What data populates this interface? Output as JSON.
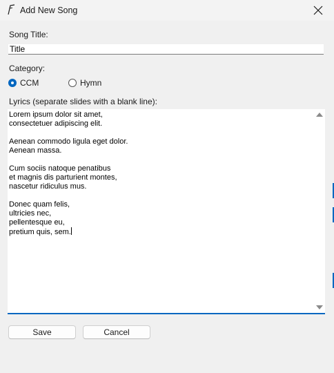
{
  "window": {
    "title": "Add New Song",
    "icon": "music-note-icon"
  },
  "form": {
    "song_title_label": "Song Title:",
    "song_title_value": "Title",
    "category_label": "Category:",
    "category_options": [
      {
        "label": "CCM",
        "checked": true
      },
      {
        "label": "Hymn",
        "checked": false
      }
    ],
    "lyrics_label": "Lyrics (separate slides with a blank line):",
    "lyrics_value": "Lorem ipsum dolor sit amet,\nconsectetuer adipiscing elit.\n\nAenean commodo ligula eget dolor.\nAenean massa.\n\nCum sociis natoque penatibus\net magnis dis parturient montes,\nnascetur ridiculus mus.\n\nDonec quam felis,\nultricies nec,\npellentesque eu,\npretium quis, sem."
  },
  "buttons": {
    "save_label": "Save",
    "cancel_label": "Cancel"
  },
  "colors": {
    "accent": "#0067c0",
    "background": "#f0f0f0"
  }
}
